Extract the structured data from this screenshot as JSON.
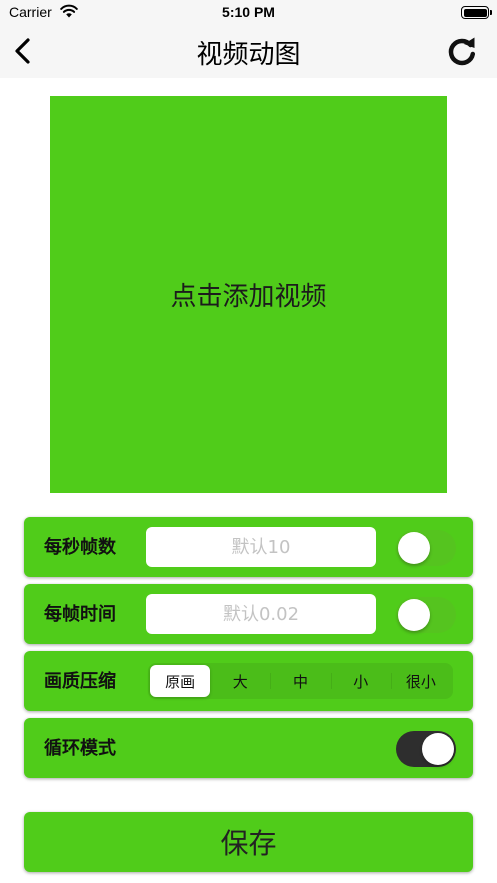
{
  "status_bar": {
    "carrier": "Carrier",
    "time": "5:10 PM"
  },
  "nav": {
    "title": "视频动图",
    "back_icon": "chevron-left-icon",
    "refresh_icon": "refresh-icon"
  },
  "video": {
    "label": "点击添加视频"
  },
  "settings": {
    "fps": {
      "label": "每秒帧数",
      "placeholder": "默认10",
      "value": "",
      "toggle_on": false
    },
    "frame_time": {
      "label": "每帧时间",
      "placeholder": "默认0.02",
      "value": "",
      "toggle_on": false
    },
    "quality": {
      "label": "画质压缩",
      "options": [
        "原画",
        "大",
        "中",
        "小",
        "很小"
      ],
      "selected": "原画"
    },
    "loop": {
      "label": "循环模式",
      "toggle_on": true
    }
  },
  "save_label": "保存",
  "colors": {
    "accent_green": "#50cc1a",
    "toggle_on": "#2e2e2e",
    "bar_background": "#f6f6f6"
  }
}
